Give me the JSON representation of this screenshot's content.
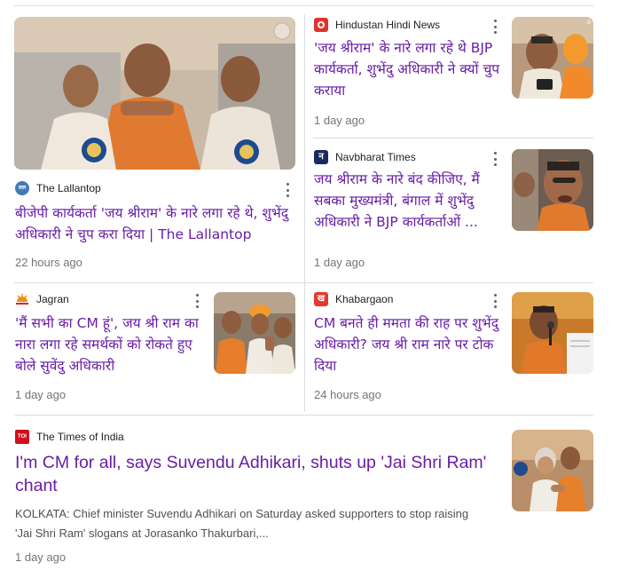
{
  "articles": [
    {
      "source": "The Lallantop",
      "title": "बीजेपी कार्यकर्ता 'जय श्रीराम' के नारे लगा रहे थे, शुभेंदु अधिकारी ने चुप करा दिया | The Lallantop",
      "time": "22 hours ago",
      "logo_icon": "lallantop-logo-icon"
    },
    {
      "source": "Hindustan Hindi News",
      "title": "'जय श्रीराम' के नारे लगा रहे थे BJP कार्यकर्ता, शुभेंदु अधिकारी ने क्यों चुप कराया",
      "time": "1 day ago",
      "logo_icon": "hindustan-logo-icon"
    },
    {
      "source": "Navbharat Times",
      "title": "जय श्रीराम के नारे बंद कीजिए, मैं सबका मुख्यमंत्री, बंगाल में शुभेंदु अधिकारी ने BJP कार्यकर्ताओं ...",
      "time": "1 day ago",
      "logo_icon": "navbharat-logo-icon"
    },
    {
      "source": "Jagran",
      "title": "'मैं सभी का CM हूं', जय श्री राम का नारा लगा रहे समर्थकों को रोकते हुए बोले सुवेंदु अधिकारी",
      "time": "1 day ago",
      "logo_icon": "jagran-logo-icon"
    },
    {
      "source": "Khabargaon",
      "title": "CM बनते ही ममता की राह पर शुभेंदु अधिकारी? जय श्री राम नारे पर टोक दिया",
      "time": "24 hours ago",
      "logo_icon": "khabargaon-logo-icon"
    },
    {
      "source": "The Times of India",
      "title": "I'm CM for all, says Suvendu Adhikari, shuts up 'Jai Shri Ram' chant",
      "snippet": "KOLKATA: Chief minister Suvendu Adhikari on Saturday asked supporters to stop raising 'Jai Shri Ram' slogans at Jorasanko Thakurbari,...",
      "time": "1 day ago",
      "logo_icon": "toi-logo-icon"
    }
  ],
  "logos": {
    "lallantop_text": "लल",
    "navbharat_text": "न",
    "khabargaon_text": "ख",
    "toi_text": "TOI"
  },
  "colors": {
    "title": "#681da8",
    "meta": "#70757a",
    "divider": "#dadce0"
  }
}
